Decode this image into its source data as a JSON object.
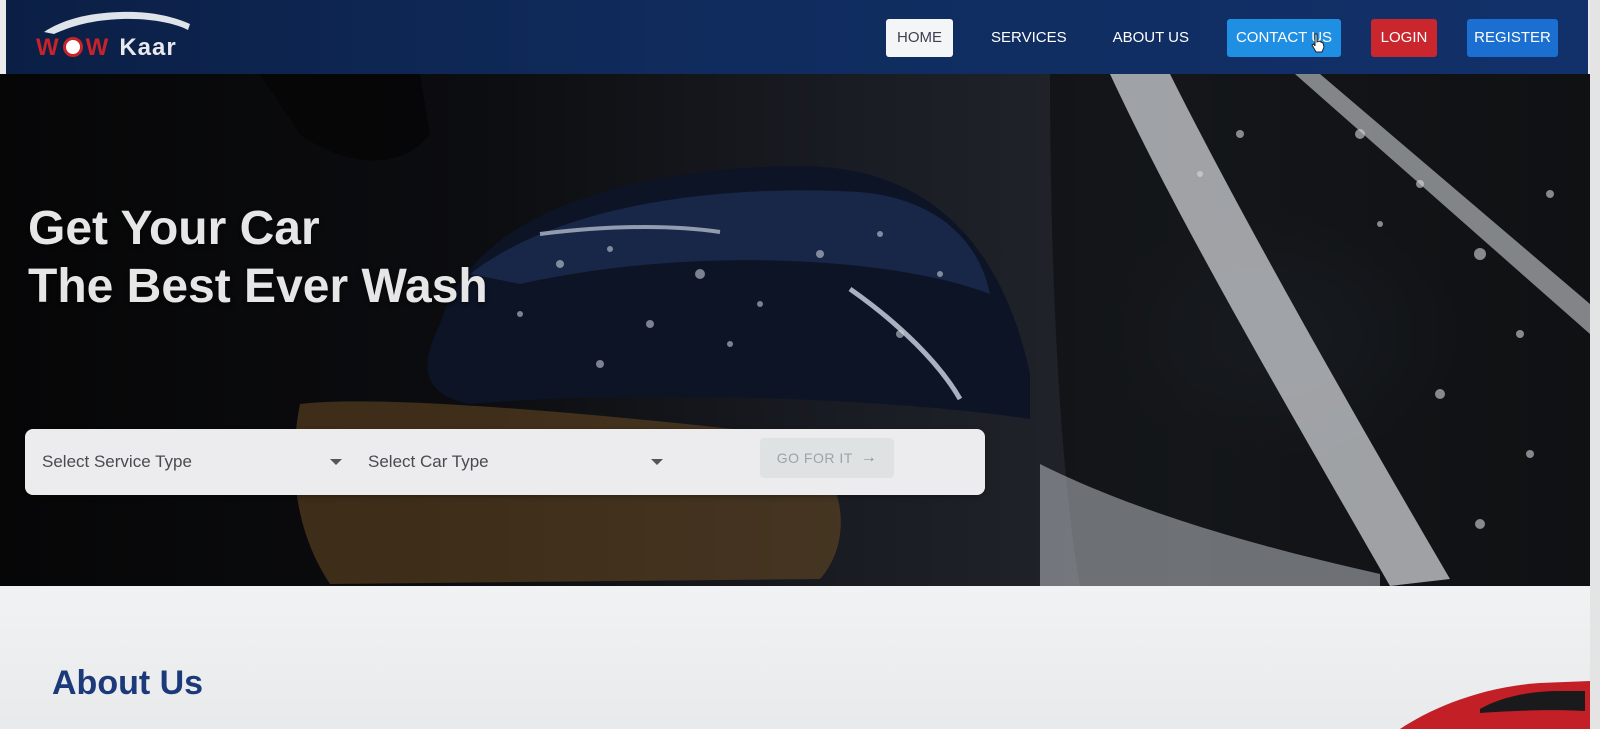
{
  "brand": {
    "logo_w1": "W",
    "logo_o": "O",
    "logo_w2": "W",
    "logo_name": "Kaar",
    "logo_icon": "car-outline-icon"
  },
  "nav": {
    "items": [
      {
        "label": "HOME"
      },
      {
        "label": "SERVICES"
      },
      {
        "label": "ABOUT US"
      },
      {
        "label": "CONTACT US"
      },
      {
        "label": "LOGIN"
      },
      {
        "label": "REGISTER"
      }
    ]
  },
  "hero": {
    "title_line1": "Get Your Car",
    "title_line2": "The Best Ever Wash"
  },
  "search": {
    "service_placeholder": "Select Service Type",
    "car_placeholder": "Select Car Type",
    "go_label": "GO FOR IT",
    "go_arrow": "→"
  },
  "about": {
    "title": "About Us"
  },
  "colors": {
    "navbar": "#102c5e",
    "home_bg": "#f4f5f7",
    "contact_bg": "#1f8fe3",
    "login_bg": "#c9262e",
    "register_bg": "#1a6fd0",
    "about_title": "#1c3a7a"
  }
}
